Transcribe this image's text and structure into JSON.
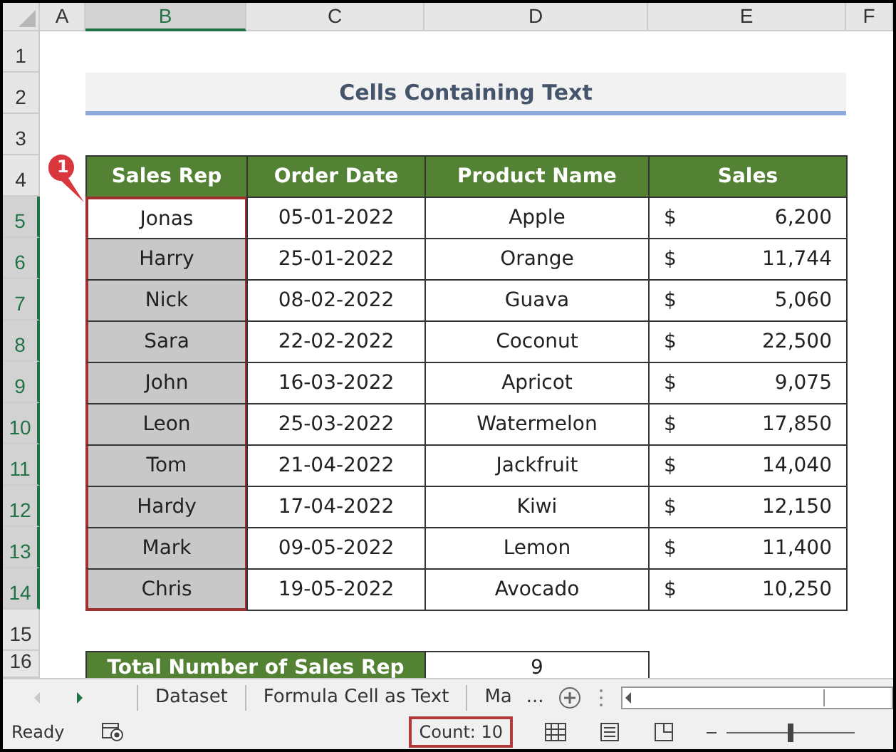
{
  "columns": [
    {
      "label": "A",
      "selected": false
    },
    {
      "label": "B",
      "selected": true
    },
    {
      "label": "C",
      "selected": false
    },
    {
      "label": "D",
      "selected": false
    },
    {
      "label": "E",
      "selected": false
    },
    {
      "label": "F",
      "selected": false
    }
  ],
  "row_headers": [
    {
      "label": "1",
      "selected": false
    },
    {
      "label": "2",
      "selected": false
    },
    {
      "label": "3",
      "selected": false
    },
    {
      "label": "4",
      "selected": false
    },
    {
      "label": "5",
      "selected": true
    },
    {
      "label": "6",
      "selected": true
    },
    {
      "label": "7",
      "selected": true
    },
    {
      "label": "8",
      "selected": true
    },
    {
      "label": "9",
      "selected": true
    },
    {
      "label": "10",
      "selected": true
    },
    {
      "label": "11",
      "selected": true
    },
    {
      "label": "12",
      "selected": true
    },
    {
      "label": "13",
      "selected": true
    },
    {
      "label": "14",
      "selected": true
    },
    {
      "label": "15",
      "selected": false
    },
    {
      "label": "16",
      "selected": false
    }
  ],
  "title": "Cells Containing Text",
  "callout": "1",
  "table": {
    "columns": [
      "Sales Rep",
      "Order Date",
      "Product Name",
      "Sales"
    ],
    "rows": [
      {
        "rep": "Jonas",
        "date": "05-01-2022",
        "product": "Apple",
        "currency": "$",
        "amount": "6,200",
        "selected": false
      },
      {
        "rep": "Harry",
        "date": "25-01-2022",
        "product": "Orange",
        "currency": "$",
        "amount": "11,744",
        "selected": true
      },
      {
        "rep": "Nick",
        "date": "08-02-2022",
        "product": "Guava",
        "currency": "$",
        "amount": "5,060",
        "selected": true
      },
      {
        "rep": "Sara",
        "date": "22-02-2022",
        "product": "Coconut",
        "currency": "$",
        "amount": "22,500",
        "selected": true
      },
      {
        "rep": "John",
        "date": "16-03-2022",
        "product": "Apricot",
        "currency": "$",
        "amount": "9,075",
        "selected": true
      },
      {
        "rep": "Leon",
        "date": "25-03-2022",
        "product": "Watermelon",
        "currency": "$",
        "amount": "17,850",
        "selected": true
      },
      {
        "rep": "Tom",
        "date": "21-04-2022",
        "product": "Jackfruit",
        "currency": "$",
        "amount": "14,040",
        "selected": true
      },
      {
        "rep": "Hardy",
        "date": "17-04-2022",
        "product": "Kiwi",
        "currency": "$",
        "amount": "12,150",
        "selected": true
      },
      {
        "rep": "Mark",
        "date": "09-05-2022",
        "product": "Lemon",
        "currency": "$",
        "amount": "11,400",
        "selected": true
      },
      {
        "rep": "Chris",
        "date": "19-05-2022",
        "product": "Avocado",
        "currency": "$",
        "amount": "10,250",
        "selected": true
      }
    ]
  },
  "summary": {
    "label": "Total Number of Sales Rep",
    "value": "9"
  },
  "sheet_tabs": [
    "Dataset",
    "Formula Cell as Text",
    "Ma"
  ],
  "more_tabs": "...",
  "status_bar": {
    "mode": "Ready",
    "count": "Count: 10",
    "zoom": {
      "level": 0.5
    }
  }
}
